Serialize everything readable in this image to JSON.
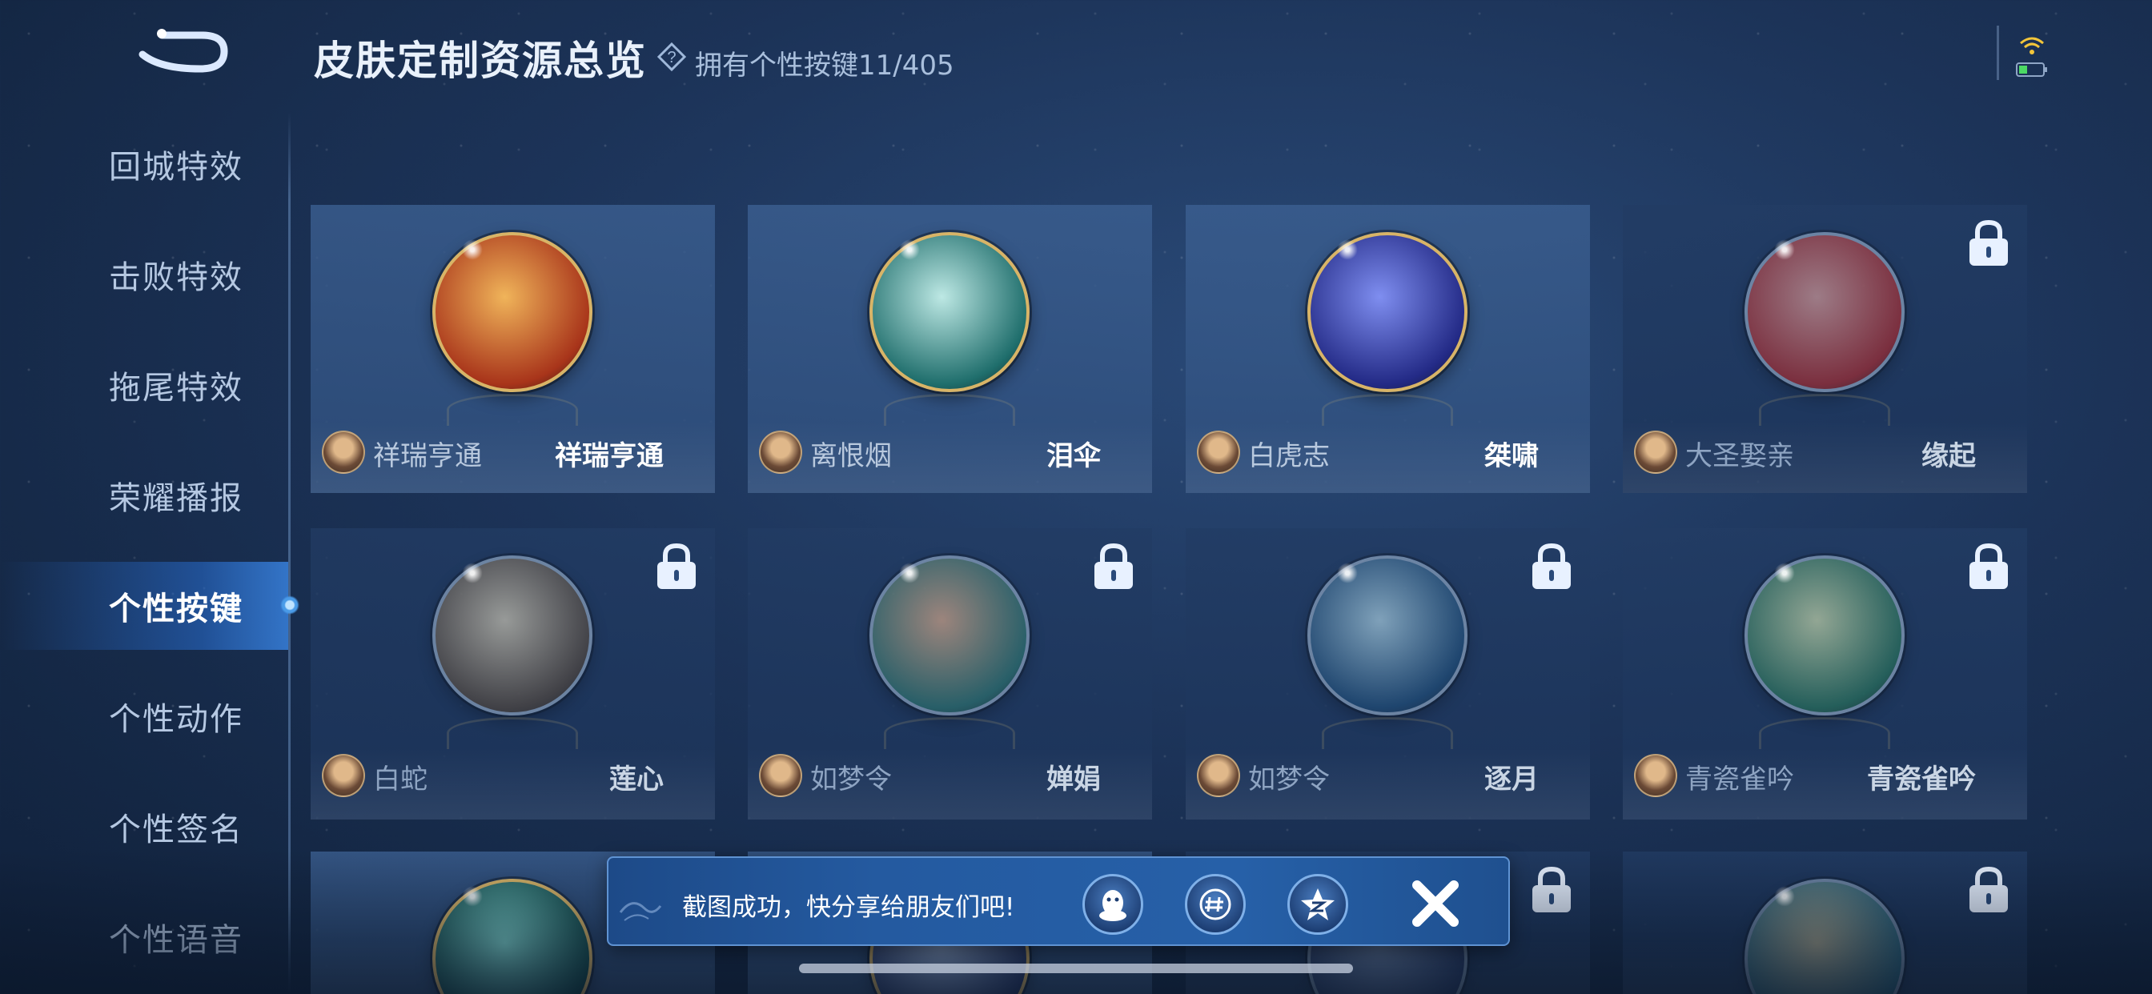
{
  "header": {
    "title": "皮肤定制资源总览",
    "owned_label": "拥有个性按键",
    "owned_count": "11/405"
  },
  "sidebar": {
    "items": [
      {
        "label": "回城特效",
        "active": false
      },
      {
        "label": "击败特效",
        "active": false
      },
      {
        "label": "拖尾特效",
        "active": false
      },
      {
        "label": "荣耀播报",
        "active": false
      },
      {
        "label": "个性按键",
        "active": true
      },
      {
        "label": "个性动作",
        "active": false
      },
      {
        "label": "个性签名",
        "active": false
      },
      {
        "label": "个性语音",
        "active": false
      }
    ]
  },
  "cards": [
    {
      "hero": "祥瑞亨通",
      "skin": "祥瑞亨通",
      "locked": false,
      "colors": [
        "#f0b45a",
        "#a8341a"
      ]
    },
    {
      "hero": "离恨烟",
      "skin": "泪伞",
      "locked": false,
      "colors": [
        "#bde8e4",
        "#1f6e6c"
      ]
    },
    {
      "hero": "白虎志",
      "skin": "桀啸",
      "locked": false,
      "colors": [
        "#7f8ef0",
        "#232a86"
      ]
    },
    {
      "hero": "大圣娶亲",
      "skin": "缘起",
      "locked": true,
      "colors": [
        "#f0a8a0",
        "#b82a2a"
      ]
    },
    {
      "hero": "白蛇",
      "skin": "莲心",
      "locked": true,
      "colors": [
        "#e8dcc0",
        "#5a4a3a"
      ]
    },
    {
      "hero": "如梦令",
      "skin": "婵娟",
      "locked": true,
      "colors": [
        "#f0b890",
        "#2f7a70"
      ]
    },
    {
      "hero": "如梦令",
      "skin": "逐月",
      "locked": true,
      "colors": [
        "#bfe6f5",
        "#1f4f7a"
      ]
    },
    {
      "hero": "青瓷雀吟",
      "skin": "青瓷雀吟",
      "locked": true,
      "colors": [
        "#e0f0b8",
        "#2a7a5a"
      ]
    },
    {
      "hero": "",
      "skin": "",
      "locked": false,
      "colors": [
        "#7fd8d0",
        "#134a4a"
      ]
    },
    {
      "hero": "",
      "skin": "",
      "locked": false,
      "colors": [
        "#9fb8e0",
        "#2a3a6a"
      ]
    },
    {
      "hero": "",
      "skin": "",
      "locked": true,
      "colors": [
        "#9fb8e0",
        "#2a3a6a"
      ]
    },
    {
      "hero": "",
      "skin": "",
      "locked": true,
      "colors": [
        "#f5e3a8",
        "#2f7a8a"
      ]
    }
  ],
  "toast": {
    "message": "截图成功，快分享给朋友们吧!",
    "share_targets": [
      "qq-icon",
      "wechat-moments-icon",
      "qzone-icon"
    ]
  }
}
